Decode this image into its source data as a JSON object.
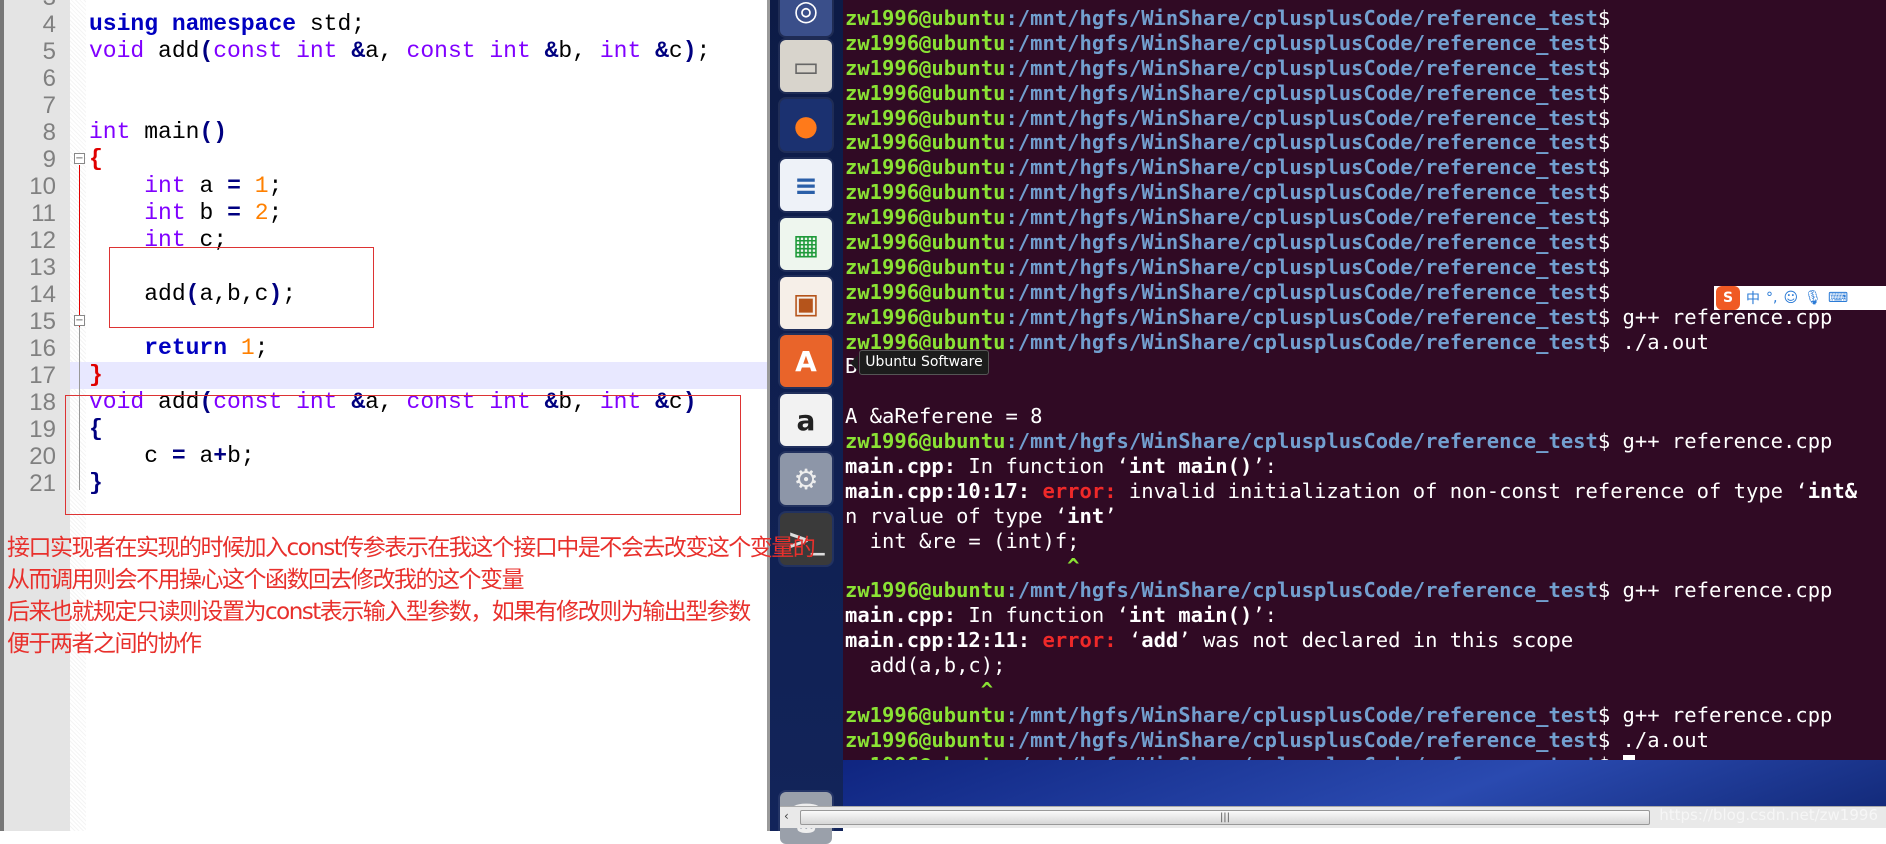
{
  "editor": {
    "lines": [
      {
        "n": "3",
        "t": []
      },
      {
        "n": "4",
        "t": [
          [
            "using",
            "kb"
          ],
          [
            " ",
            "pl"
          ],
          [
            "namespace",
            "kb"
          ],
          [
            " std;",
            "pl"
          ]
        ]
      },
      {
        "n": "5",
        "t": [
          [
            "void",
            "kw"
          ],
          [
            " add",
            "pl"
          ],
          [
            "(",
            "op"
          ],
          [
            "const",
            "kw"
          ],
          [
            " ",
            "pl"
          ],
          [
            "int",
            "kw"
          ],
          [
            " ",
            "pl"
          ],
          [
            "&",
            "op"
          ],
          [
            "a, ",
            "pl"
          ],
          [
            "const",
            "kw"
          ],
          [
            " ",
            "pl"
          ],
          [
            "int",
            "kw"
          ],
          [
            " ",
            "pl"
          ],
          [
            "&",
            "op"
          ],
          [
            "b, ",
            "pl"
          ],
          [
            "int",
            "kw"
          ],
          [
            " ",
            "pl"
          ],
          [
            "&",
            "op"
          ],
          [
            "c",
            "pl"
          ],
          [
            ")",
            "op"
          ],
          [
            ";",
            "pl"
          ]
        ]
      },
      {
        "n": "6",
        "t": []
      },
      {
        "n": "7",
        "t": []
      },
      {
        "n": "8",
        "t": [
          [
            "int",
            "kw"
          ],
          [
            " main",
            "pl"
          ],
          [
            "()",
            "op"
          ]
        ]
      },
      {
        "n": "9",
        "t": [
          [
            "{",
            "rb"
          ]
        ]
      },
      {
        "n": "10",
        "t": [
          [
            "    ",
            "pl"
          ],
          [
            "int",
            "kw"
          ],
          [
            " a ",
            "pl"
          ],
          [
            "=",
            "op"
          ],
          [
            " ",
            "pl"
          ],
          [
            "1",
            "nm"
          ],
          [
            ";",
            "pl"
          ]
        ]
      },
      {
        "n": "11",
        "t": [
          [
            "    ",
            "pl"
          ],
          [
            "int",
            "kw"
          ],
          [
            " b ",
            "pl"
          ],
          [
            "=",
            "op"
          ],
          [
            " ",
            "pl"
          ],
          [
            "2",
            "nm"
          ],
          [
            ";",
            "pl"
          ]
        ]
      },
      {
        "n": "12",
        "t": [
          [
            "    ",
            "pl"
          ],
          [
            "int",
            "kw"
          ],
          [
            " c;",
            "pl"
          ]
        ]
      },
      {
        "n": "13",
        "t": []
      },
      {
        "n": "14",
        "t": [
          [
            "    add",
            "pl"
          ],
          [
            "(",
            "op"
          ],
          [
            "a,b,c",
            "pl"
          ],
          [
            ")",
            "op"
          ],
          [
            ";",
            "pl"
          ]
        ]
      },
      {
        "n": "15",
        "t": []
      },
      {
        "n": "16",
        "t": [
          [
            "    ",
            "pl"
          ],
          [
            "return",
            "kb"
          ],
          [
            " ",
            "pl"
          ],
          [
            "1",
            "nm"
          ],
          [
            ";",
            "pl"
          ]
        ]
      },
      {
        "n": "17",
        "t": [
          [
            "}",
            "rb"
          ]
        ],
        "highlight": true
      },
      {
        "n": "18",
        "t": [
          [
            "void",
            "kw"
          ],
          [
            " add",
            "pl"
          ],
          [
            "(",
            "op"
          ],
          [
            "const",
            "kw"
          ],
          [
            " ",
            "pl"
          ],
          [
            "int",
            "kw"
          ],
          [
            " ",
            "pl"
          ],
          [
            "&",
            "op"
          ],
          [
            "a, ",
            "pl"
          ],
          [
            "const",
            "kw"
          ],
          [
            " ",
            "pl"
          ],
          [
            "int",
            "kw"
          ],
          [
            " ",
            "pl"
          ],
          [
            "&",
            "op"
          ],
          [
            "b, ",
            "pl"
          ],
          [
            "int",
            "kw"
          ],
          [
            " ",
            "pl"
          ],
          [
            "&",
            "op"
          ],
          [
            "c",
            "pl"
          ],
          [
            ")",
            "op"
          ]
        ]
      },
      {
        "n": "19",
        "t": [
          [
            "{",
            "op"
          ]
        ]
      },
      {
        "n": "20",
        "t": [
          [
            "    c ",
            "pl"
          ],
          [
            "=",
            "op"
          ],
          [
            " a",
            "pl"
          ],
          [
            "+",
            "op"
          ],
          [
            "b;",
            "pl"
          ]
        ]
      },
      {
        "n": "21",
        "t": [
          [
            "}",
            "op"
          ]
        ]
      }
    ]
  },
  "annotation": [
    "接口实现者在实现的时候加入const传参表示在我这个接口中是不会去改变这个变量的",
    "从而调用则会不用操心这个函数回去修改我的这个变量",
    "后来也就规定只读则设置为const表示输入型参数，如果有修改则为输出型参数",
    "便于两者之间的协作"
  ],
  "launcher": {
    "icons": [
      "ubuntu-icon",
      "files-icon",
      "firefox-icon",
      "writer-icon",
      "calc-icon",
      "impress-icon",
      "ubuntu-software-icon",
      "amazon-icon",
      "settings-icon",
      "terminal-icon"
    ],
    "tooltip": "Ubuntu Software"
  },
  "terminal": {
    "user": "zw1996@ubuntu",
    "path": ":/mnt/hgfs/WinShare/cplusplusCode/reference_test",
    "lines": [
      [
        [
          "P"
        ]
      ],
      [
        [
          "P"
        ]
      ],
      [
        [
          "P"
        ]
      ],
      [
        [
          "P"
        ]
      ],
      [
        [
          "P"
        ]
      ],
      [
        [
          "P"
        ]
      ],
      [
        [
          "P"
        ]
      ],
      [
        [
          "P"
        ]
      ],
      [
        [
          "P"
        ]
      ],
      [
        [
          "P"
        ]
      ],
      [
        [
          "P"
        ]
      ],
      [
        [
          "P"
        ]
      ],
      [
        [
          "P"
        ],
        [
          "$ g++ reference.cpp",
          "w"
        ]
      ],
      [
        [
          "P"
        ],
        [
          "$ ./a.out",
          "w"
        ]
      ],
      [
        [
          "B b = 16",
          "w"
        ]
      ],
      [
        [
          "",
          "w"
        ]
      ],
      [
        [
          "A &aReferene = 8",
          "w"
        ]
      ],
      [
        [
          "P"
        ],
        [
          "$ g++ reference.cpp",
          "w"
        ]
      ],
      [
        [
          "main.cpp:",
          "b"
        ],
        [
          " In function ‘",
          "w"
        ],
        [
          "int main()",
          "b"
        ],
        [
          "’:",
          "w"
        ]
      ],
      [
        [
          "main.cpp:10:17:",
          "b"
        ],
        [
          " ",
          "w"
        ],
        [
          "error:",
          "e"
        ],
        [
          " invalid initialization of non-const reference of type ‘",
          "w"
        ],
        [
          "int&",
          "b"
        ]
      ],
      [
        [
          "n rvalue of type ‘",
          "w"
        ],
        [
          "int",
          "b"
        ],
        [
          "’",
          "w"
        ]
      ],
      [
        [
          "  int &re = (int)f;",
          "w"
        ]
      ],
      [
        [
          "                  ^",
          "g"
        ]
      ],
      [
        [
          "P"
        ],
        [
          "$ g++ reference.cpp",
          "w"
        ]
      ],
      [
        [
          "main.cpp:",
          "b"
        ],
        [
          " In function ‘",
          "w"
        ],
        [
          "int main()",
          "b"
        ],
        [
          "’:",
          "w"
        ]
      ],
      [
        [
          "main.cpp:12:11:",
          "b"
        ],
        [
          " ",
          "w"
        ],
        [
          "error:",
          "e"
        ],
        [
          " ‘",
          "w"
        ],
        [
          "add",
          "b"
        ],
        [
          "’ was not declared in this scope",
          "w"
        ]
      ],
      [
        [
          "  add(a,b,c);",
          "w"
        ]
      ],
      [
        [
          "           ^",
          "g"
        ]
      ],
      [
        [
          "P"
        ],
        [
          "$ g++ reference.cpp",
          "w"
        ]
      ],
      [
        [
          "P"
        ],
        [
          "$ ./a.out",
          "w"
        ]
      ],
      [
        [
          "P"
        ],
        [
          "$ ",
          "w"
        ],
        [
          "CURSOR"
        ]
      ]
    ]
  },
  "ime": {
    "logo": "S",
    "mode": "中",
    "punct": "°,"
  },
  "watermark": "https://blog.csdn.net/zw1996",
  "colors": {
    "terminal_bg": "#300a24",
    "prompt_user": "#8ae234",
    "prompt_path": "#729fcf",
    "error": "#ef2929",
    "annotation": "#e8302c",
    "keyword": "#8000ff"
  }
}
